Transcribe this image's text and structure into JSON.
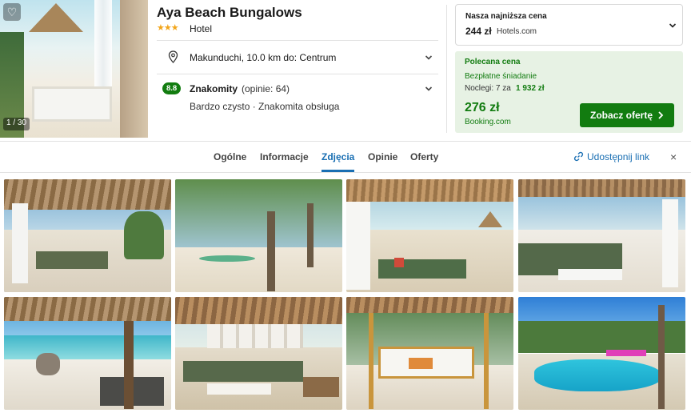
{
  "hotel": {
    "name": "Aya Beach Bungalows",
    "stars": "★★★",
    "type": "Hotel",
    "location": "Makunduchi, 10.0 km do: Centrum",
    "photo_counter": "1 / 30"
  },
  "rating": {
    "score": "8.8",
    "label": "Znakomity",
    "count": "(opinie: 64)",
    "tags": "Bardzo czysto · Znakomita obsługa"
  },
  "lowest_price": {
    "title": "Nasza najniższa cena",
    "price": "244 zł",
    "site": "Hotels.com"
  },
  "featured_offer": {
    "title": "Polecana cena",
    "breakfast": "Bezpłatne śniadanie",
    "nights_label": "Noclegi: 7 za",
    "nights_total": "1 932 zł",
    "price": "276 zł",
    "site": "Booking.com",
    "button_label": "Zobacz ofertę"
  },
  "tabs": [
    {
      "label": "Ogólne",
      "active": false
    },
    {
      "label": "Informacje",
      "active": false
    },
    {
      "label": "Zdjęcia",
      "active": true
    },
    {
      "label": "Opinie",
      "active": false
    },
    {
      "label": "Oferty",
      "active": false
    }
  ],
  "share_label": "Udostępnij link",
  "close_icon": "×",
  "icons": [
    "heart-icon",
    "location-pin-icon",
    "chevron-down-icon",
    "chevron-right-icon",
    "link-icon",
    "close-icon"
  ],
  "colors": {
    "accent_blue": "#1a6fb3",
    "offer_green": "#127c10",
    "offer_background": "#e7f2e4",
    "star_yellow": "#f2a51a"
  }
}
